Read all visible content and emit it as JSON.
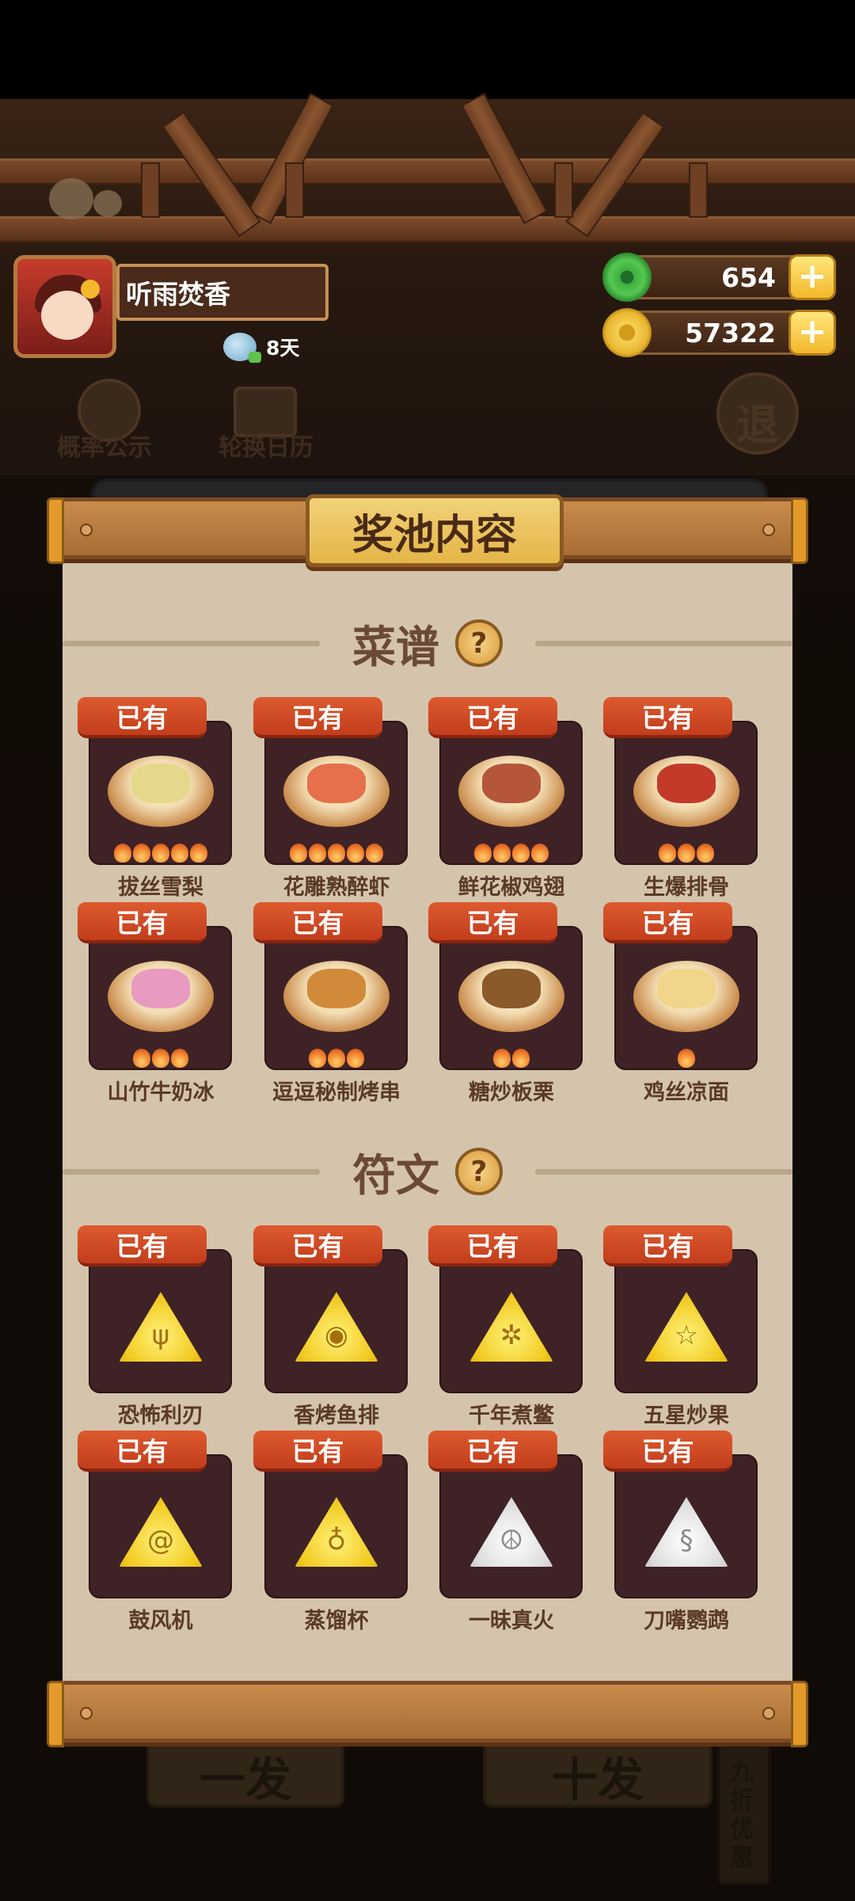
{
  "player": {
    "name": "听雨焚香",
    "days": "8天"
  },
  "currency": {
    "jade": "654",
    "gold": "57322",
    "add_label": "+"
  },
  "background": {
    "prob_label": "概率公示",
    "calendar_label": "轮换日历",
    "exit_label": "退",
    "one_draw": "一发",
    "ten_draw": "十发",
    "discount": "九折优惠"
  },
  "panel": {
    "title": "奖池内容"
  },
  "recipes": {
    "title": "菜谱",
    "help": "?",
    "owned_label": "已有",
    "items": [
      {
        "name": "拔丝雪梨",
        "stars": 5,
        "food": "#e6d88a"
      },
      {
        "name": "花雕熟醉虾",
        "stars": 5,
        "food": "#e6704a"
      },
      {
        "name": "鲜花椒鸡翅",
        "stars": 4,
        "food": "#b5563a"
      },
      {
        "name": "生爆排骨",
        "stars": 3,
        "food": "#c33a2a"
      },
      {
        "name": "山竹牛奶冰",
        "stars": 3,
        "food": "#e89ac0"
      },
      {
        "name": "逗逗秘制烤串",
        "stars": 3,
        "food": "#d08a3a"
      },
      {
        "name": "糖炒板栗",
        "stars": 2,
        "food": "#8a5a2a"
      },
      {
        "name": "鸡丝凉面",
        "stars": 1,
        "food": "#f0d58a"
      }
    ]
  },
  "runes": {
    "title": "符文",
    "help": "?",
    "owned_label": "已有",
    "items": [
      {
        "name": "恐怖利刃",
        "color": "gold",
        "glyph": "ψ"
      },
      {
        "name": "香烤鱼排",
        "color": "gold",
        "glyph": "◉"
      },
      {
        "name": "千年煮鳖",
        "color": "gold",
        "glyph": "✲"
      },
      {
        "name": "五星炒果",
        "color": "gold",
        "glyph": "☆"
      },
      {
        "name": "鼓风机",
        "color": "gold",
        "glyph": "@"
      },
      {
        "name": "蒸馏杯",
        "color": "gold",
        "glyph": "♁"
      },
      {
        "name": "一昧真火",
        "color": "white",
        "glyph": "☮"
      },
      {
        "name": "刀嘴鹦鹉",
        "color": "white",
        "glyph": "§"
      }
    ]
  }
}
